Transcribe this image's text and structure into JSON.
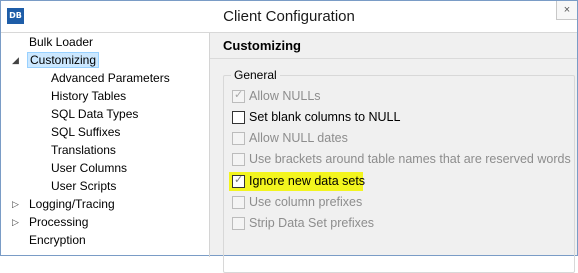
{
  "window": {
    "title": "Client Configuration",
    "icon_text": "DB",
    "close_glyph": "×"
  },
  "tree": {
    "items": [
      {
        "label": "Bulk Loader",
        "expander": ""
      },
      {
        "label": "Customizing",
        "expander": "◢",
        "selected": true
      },
      {
        "label": "Advanced Parameters"
      },
      {
        "label": "History Tables"
      },
      {
        "label": "SQL Data Types"
      },
      {
        "label": "SQL Suffixes"
      },
      {
        "label": "Translations"
      },
      {
        "label": "User Columns"
      },
      {
        "label": "User Scripts"
      },
      {
        "label": "Logging/Tracing",
        "expander": "▷"
      },
      {
        "label": "Processing",
        "expander": "▷"
      },
      {
        "label": "Encryption",
        "expander": ""
      }
    ]
  },
  "panel": {
    "header": "Customizing",
    "group_title": "General",
    "options": [
      {
        "label": "Allow NULLs",
        "checked": true,
        "disabled": true
      },
      {
        "label": "Set blank columns to NULL",
        "checked": false,
        "disabled": false
      },
      {
        "label": "Allow NULL dates",
        "checked": false,
        "disabled": true
      },
      {
        "label": "Use brackets around table names that are reserved words",
        "checked": false,
        "disabled": true
      },
      {
        "label": "Ignore new data sets",
        "checked": true,
        "disabled": false,
        "highlighted": true
      },
      {
        "label": "Use column prefixes",
        "checked": false,
        "disabled": true
      },
      {
        "label": "Strip Data Set prefixes",
        "checked": false,
        "disabled": true
      }
    ]
  },
  "colors": {
    "highlight": "#f3f51e",
    "selection": "#cce8ff",
    "icon": "#1e5da8"
  }
}
